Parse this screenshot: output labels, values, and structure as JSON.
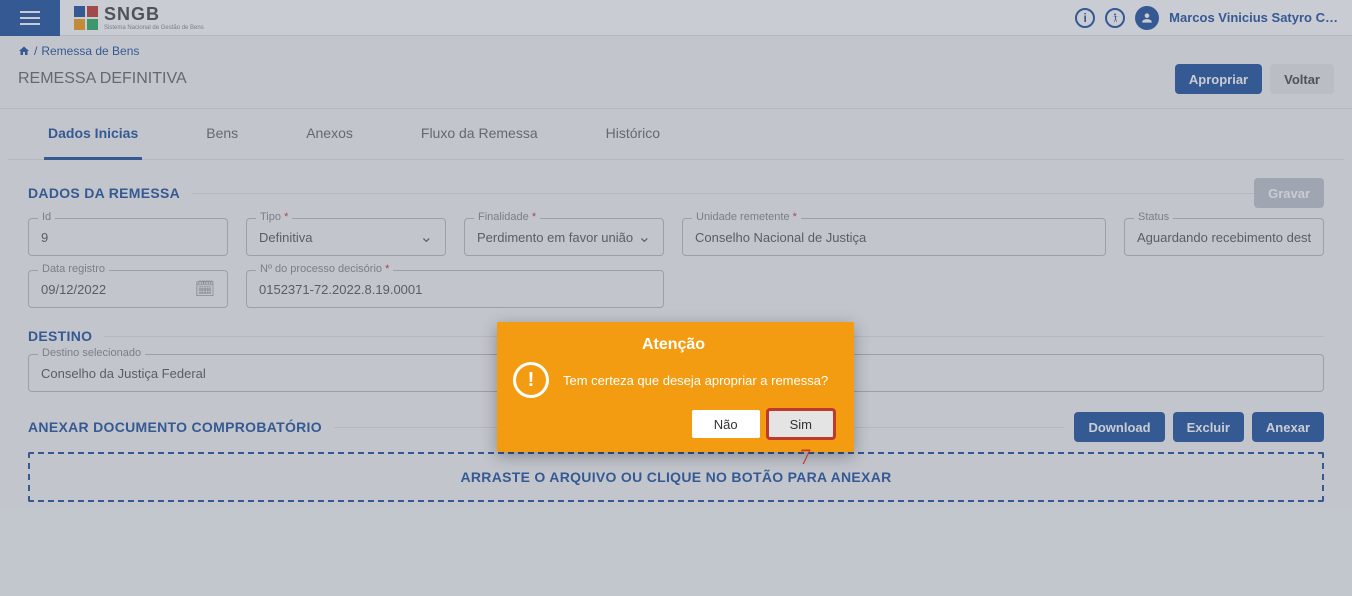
{
  "header": {
    "logo_text": "SNGB",
    "logo_sub": "Sistema Nacional de Gestão de Bens",
    "username": "Marcos Vinicius Satyro C…"
  },
  "breadcrumb": {
    "sep": "/",
    "item": "Remessa de Bens"
  },
  "page": {
    "title": "REMESSA DEFINITIVA",
    "apropriar": "Apropriar",
    "voltar": "Voltar"
  },
  "tabs": {
    "dados": "Dados Inicias",
    "bens": "Bens",
    "anexos": "Anexos",
    "fluxo": "Fluxo da Remessa",
    "historico": "Histórico"
  },
  "remessa": {
    "title": "DADOS DA REMESSA",
    "gravar": "Gravar",
    "id_label": "Id",
    "id_value": "9",
    "tipo_label": "Tipo",
    "tipo_value": "Definitiva",
    "finalidade_label": "Finalidade",
    "finalidade_value": "Perdimento em favor união",
    "unidade_label": "Unidade remetente",
    "unidade_value": "Conselho Nacional de Justiça",
    "status_label": "Status",
    "status_value": "Aguardando recebimento destin:",
    "data_label": "Data registro",
    "data_value": "09/12/2022",
    "proc_label": "Nº do processo decisório",
    "proc_value": "0152371-72.2022.8.19.0001"
  },
  "destino": {
    "title": "DESTINO",
    "label": "Destino selecionado",
    "value": "Conselho da Justiça Federal"
  },
  "anexo": {
    "title": "ANEXAR DOCUMENTO COMPROBATÓRIO",
    "download": "Download",
    "excluir": "Excluir",
    "anexar": "Anexar",
    "dropzone": "ARRASTE O ARQUIVO OU CLIQUE NO BOTÃO PARA ANEXAR"
  },
  "modal": {
    "title": "Atenção",
    "message": "Tem certeza que deseja apropriar a remessa?",
    "no": "Não",
    "yes": "Sim"
  },
  "annotation": "7"
}
